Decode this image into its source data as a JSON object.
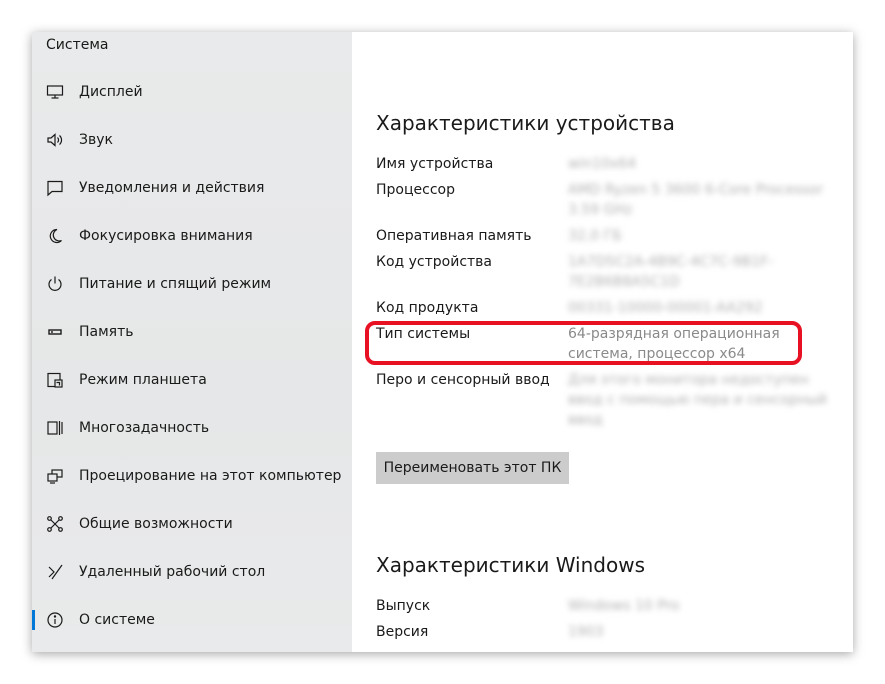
{
  "sidebar": {
    "title": "Система",
    "items": [
      {
        "label": "Дисплей",
        "icon": "monitor-icon"
      },
      {
        "label": "Звук",
        "icon": "speaker-icon"
      },
      {
        "label": "Уведомления и действия",
        "icon": "notification-icon"
      },
      {
        "label": "Фокусировка внимания",
        "icon": "moon-icon"
      },
      {
        "label": "Питание и спящий режим",
        "icon": "power-icon"
      },
      {
        "label": "Память",
        "icon": "storage-icon"
      },
      {
        "label": "Режим планшета",
        "icon": "tablet-icon"
      },
      {
        "label": "Многозадачность",
        "icon": "multitasking-icon"
      },
      {
        "label": "Проецирование на этот компьютер",
        "icon": "projecting-icon"
      },
      {
        "label": "Общие возможности",
        "icon": "shared-experiences-icon"
      },
      {
        "label": "Удаленный рабочий стол",
        "icon": "remote-desktop-icon"
      },
      {
        "label": "О системе",
        "icon": "info-icon",
        "selected": true
      }
    ]
  },
  "device_specs": {
    "title": "Характеристики устройства",
    "rows": [
      {
        "label": "Имя устройства",
        "value": "win10x64",
        "blurred": true
      },
      {
        "label": "Процессор",
        "value": "AMD Ryzen 5 3600 6-Core Processor 3.59 GHz",
        "blurred": true
      },
      {
        "label": "Оперативная память",
        "value": "32,0 ГБ",
        "blurred": true
      },
      {
        "label": "Код устройства",
        "value": "1A7D5C2A-4B9C-4C7C-9B1F-7E2B6B8A5C1D",
        "blurred": true
      },
      {
        "label": "Код продукта",
        "value": "00331-10000-00001-AA292",
        "blurred": true
      },
      {
        "label": "Тип системы",
        "value": "64-разрядная операционная система, процессор x64",
        "blurred": false
      },
      {
        "label": "Перо и сенсорный ввод",
        "value": "Для этого монитора недоступен ввод с помощью пера и сенсорный ввод",
        "blurred": true
      }
    ],
    "rename_button": "Переименовать этот ПК"
  },
  "windows_specs": {
    "title": "Характеристики Windows",
    "rows": [
      {
        "label": "Выпуск",
        "value": "Windows 10 Pro",
        "blurred": true
      },
      {
        "label": "Версия",
        "value": "1903",
        "blurred": true
      }
    ]
  },
  "colors": {
    "accent": "#0078d7",
    "highlight": "#e81123"
  }
}
